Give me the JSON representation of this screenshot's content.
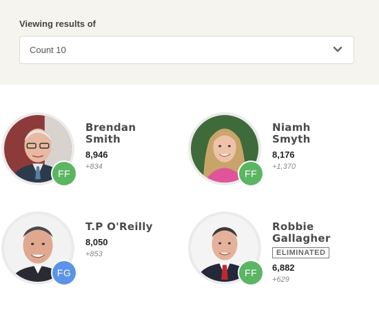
{
  "filter": {
    "label": "Viewing results of",
    "selected": "Count 10"
  },
  "colors": {
    "panel_bg": "#f6f4ef",
    "FF": "#5bb562",
    "FG": "#5b93e6"
  },
  "candidates": [
    {
      "first": "Brendan",
      "last": "Smith",
      "party": "FF",
      "votes": "8,946",
      "transfer": "+834",
      "status": ""
    },
    {
      "first": "Niamh",
      "last": "Smyth",
      "party": "FF",
      "votes": "8,176",
      "transfer": "+1,370",
      "status": ""
    },
    {
      "full": "T.P O'Reilly",
      "party": "FG",
      "votes": "8,050",
      "transfer": "+853",
      "status": ""
    },
    {
      "first": "Robbie",
      "last": "Gallagher",
      "party": "FF",
      "votes": "6,882",
      "transfer": "+629",
      "status": "ELIMINATED"
    }
  ]
}
